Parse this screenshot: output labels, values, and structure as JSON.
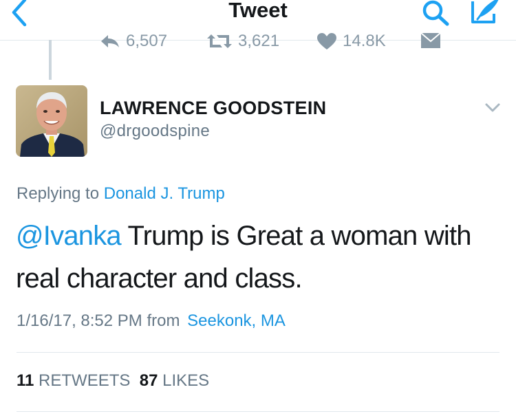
{
  "nav": {
    "title": "Tweet"
  },
  "parent_tweet": {
    "replies": "6,507",
    "retweets": "3,621",
    "likes": "14.8K"
  },
  "tweet": {
    "author_name": "LAWRENCE GOODSTEIN",
    "author_handle": "@drgoodspine",
    "replying_prefix": "Replying to",
    "replying_to": "Donald J. Trump",
    "mention": "@Ivanka",
    "text_line1_rest": " Trump is Great a woman with",
    "text_line2": "real character and class.",
    "timestamp": "1/16/17, 8:52 PM from",
    "location": "Seekonk, MA"
  },
  "engagement": {
    "retweets_count": "11",
    "retweets_label": "RETWEETS",
    "likes_count": "87",
    "likes_label": "LIKES"
  },
  "colors": {
    "link": "#1b95e0",
    "icon": "#1da1f2",
    "muted": "#657786",
    "action": "#8899a6"
  },
  "icons": {
    "back": "chevron-left-icon",
    "search": "search-icon",
    "compose": "compose-icon",
    "reply": "reply-icon",
    "retweet": "retweet-icon",
    "like": "heart-icon",
    "message": "direct-message-icon",
    "caret": "chevron-down-icon"
  }
}
